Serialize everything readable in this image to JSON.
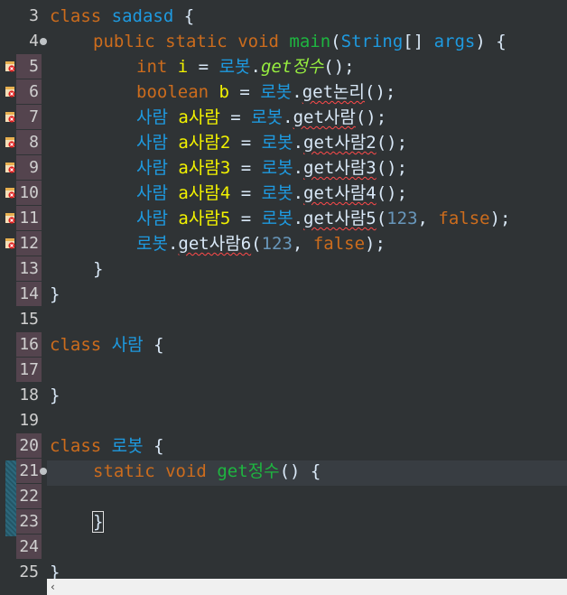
{
  "lines": [
    {
      "n": "3"
    },
    {
      "n": "4"
    },
    {
      "n": "5"
    },
    {
      "n": "6"
    },
    {
      "n": "7"
    },
    {
      "n": "8"
    },
    {
      "n": "9"
    },
    {
      "n": "10"
    },
    {
      "n": "11"
    },
    {
      "n": "12"
    },
    {
      "n": "13"
    },
    {
      "n": "14"
    },
    {
      "n": "15"
    },
    {
      "n": "16"
    },
    {
      "n": "17"
    },
    {
      "n": "18"
    },
    {
      "n": "19"
    },
    {
      "n": "20"
    },
    {
      "n": "21"
    },
    {
      "n": "22"
    },
    {
      "n": "23"
    },
    {
      "n": "24"
    },
    {
      "n": "25"
    }
  ],
  "code": {
    "class_kw": "class",
    "sadasd": "sadasd",
    "brace_open": " {",
    "brace_close": "}",
    "public": "public",
    "static": "static",
    "void": "void",
    "main": "main",
    "String": "String",
    "args_open": "[] ",
    "args": "args",
    "args_close": ") {",
    "int": "int",
    "i": "i",
    "boolean": "boolean",
    "b": "b",
    "eq": " = ",
    "robot": "로봇",
    "dot": ".",
    "get_int": "get정수",
    "call_end": "();",
    "get_bool": "get논리",
    "person": "사람",
    "a_person": "a사람",
    "get_person": "get사람",
    "a_person2": "a사람2",
    "get_person2": "get사람2",
    "a_person3": "a사람3",
    "get_person3": "get사람3",
    "a_person4": "a사람4",
    "get_person4": "get사람4",
    "a_person5": "a사람5",
    "get_person5": "get사람5",
    "get_person6": "get사람6",
    "paren_open": "(",
    "num_123": "123",
    "comma": ", ",
    "false": "false",
    "paren_close_semi": ");",
    "get_int_decl": "get정수",
    "decl_parens": "() {"
  },
  "scroll": {
    "left_arrow": "‹"
  },
  "colors": {
    "background": "#2f3335",
    "keyword": "#cc6c1d",
    "type": "#1e9ae0",
    "variable": "#f2f200",
    "method_decl": "#1eb540",
    "static_method": "#96ec3f",
    "number": "#6897bb",
    "error_underline": "#ff4a4a"
  }
}
